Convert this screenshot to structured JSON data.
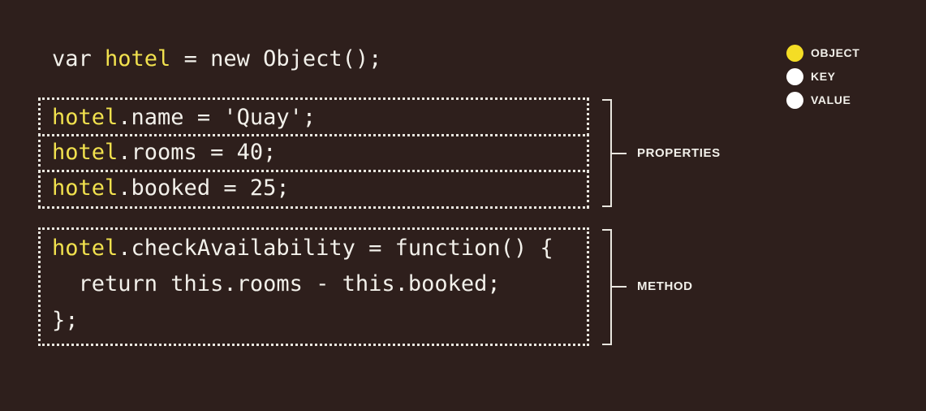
{
  "code": {
    "line1": {
      "pre": "var ",
      "obj": "hotel",
      "post": " = new Object();"
    },
    "properties": [
      {
        "obj": "hotel",
        "post": ".name = 'Quay';"
      },
      {
        "obj": "hotel",
        "post": ".rooms = 40;"
      },
      {
        "obj": "hotel",
        "post": ".booked = 25;"
      }
    ],
    "method": {
      "line1": {
        "obj": "hotel",
        "post": ".checkAvailability = function() {"
      },
      "line2": "  return this.rooms - this.booked;",
      "line3": "};"
    }
  },
  "brackets": {
    "properties_label": "PROPERTIES",
    "method_label": "METHOD"
  },
  "legend": [
    {
      "label": "OBJECT",
      "color": "#f4dd25"
    },
    {
      "label": "KEY",
      "color": "#ffffff"
    },
    {
      "label": "VALUE",
      "color": "#ffffff"
    }
  ],
  "colors": {
    "background": "#2e1f1c",
    "highlight": "#f1e14e",
    "text": "#f2f0ea"
  }
}
